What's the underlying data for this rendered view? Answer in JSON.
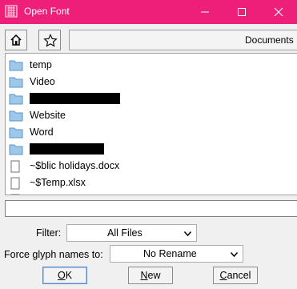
{
  "window": {
    "title": "Open Font"
  },
  "toolbar": {
    "path_label": "Documents"
  },
  "files": [
    {
      "type": "folder",
      "name": "temp",
      "redacted": false
    },
    {
      "type": "folder",
      "name": "Video",
      "redacted": false
    },
    {
      "type": "folder",
      "name": "",
      "redacted": true
    },
    {
      "type": "folder",
      "name": "Website",
      "redacted": false
    },
    {
      "type": "folder",
      "name": "Word",
      "redacted": false
    },
    {
      "type": "folder",
      "name": "",
      "redacted": true
    },
    {
      "type": "file",
      "name": "~$blic holidays.docx",
      "redacted": false
    },
    {
      "type": "file",
      "name": "~$Temp.xlsx",
      "redacted": false
    }
  ],
  "filename": {
    "value": ""
  },
  "filter": {
    "label": "Filter:",
    "selected": "All Files"
  },
  "glyph_names": {
    "label": "Force glyph names to:",
    "selected": "No Rename"
  },
  "buttons": {
    "ok": {
      "first": "O",
      "rest": "K"
    },
    "new": {
      "first": "N",
      "rest": "ew"
    },
    "cancel": {
      "first": "C",
      "rest": "ancel"
    }
  },
  "colors": {
    "titlebar": "#ee1f78",
    "folder": "#9ec8ea"
  }
}
